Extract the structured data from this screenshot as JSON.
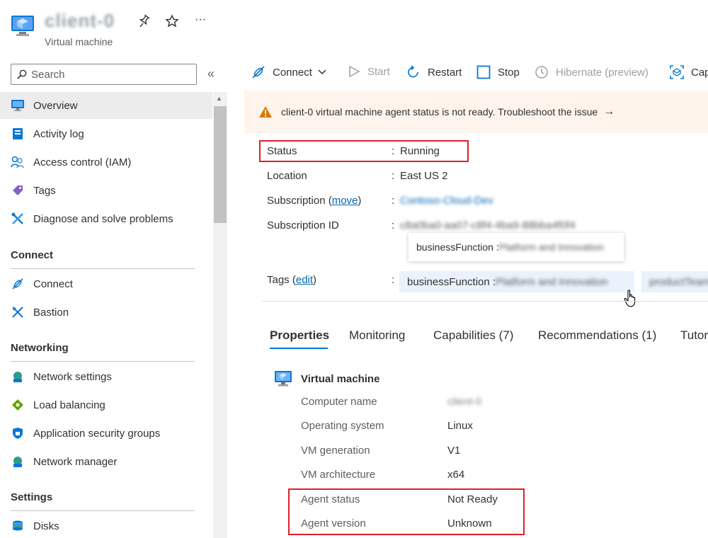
{
  "header": {
    "title": "client-0",
    "subtitle": "Virtual machine",
    "pin_icon": "pin-icon",
    "favorite_icon": "star-icon",
    "more_label": "···"
  },
  "sidebar": {
    "search_placeholder": "Search",
    "collapse_label": "«",
    "items": [
      {
        "label": "Overview",
        "icon": "overview-icon",
        "active": true
      },
      {
        "label": "Activity log",
        "icon": "activity-log-icon"
      },
      {
        "label": "Access control (IAM)",
        "icon": "people-icon"
      },
      {
        "label": "Tags",
        "icon": "tag-icon"
      },
      {
        "label": "Diagnose and solve problems",
        "icon": "wrench-icon"
      }
    ],
    "sections": [
      {
        "title": "Connect",
        "items": [
          {
            "label": "Connect",
            "icon": "connect-icon"
          },
          {
            "label": "Bastion",
            "icon": "bastion-icon"
          }
        ]
      },
      {
        "title": "Networking",
        "items": [
          {
            "label": "Network settings",
            "icon": "network-icon"
          },
          {
            "label": "Load balancing",
            "icon": "load-balancer-icon"
          },
          {
            "label": "Application security groups",
            "icon": "shield-icon"
          },
          {
            "label": "Network manager",
            "icon": "network-manager-icon"
          }
        ]
      },
      {
        "title": "Settings",
        "items": [
          {
            "label": "Disks",
            "icon": "disks-icon"
          }
        ]
      }
    ]
  },
  "toolbar": {
    "connect": "Connect",
    "start": "Start",
    "restart": "Restart",
    "stop": "Stop",
    "hibernate": "Hibernate (preview)",
    "capture": "Cap"
  },
  "banner": {
    "text": "client-0 virtual machine agent status is not ready. Troubleshoot the issue",
    "arrow": "→"
  },
  "essentials": {
    "status_label": "Status",
    "status_value": "Running",
    "location_label": "Location",
    "location_value": "East US 2",
    "subscription_label_prefix": "Subscription (",
    "subscription_move": "move",
    "subscription_label_suffix": ")",
    "subscription_value": "Contoso-Cloud-Dev",
    "subscription_id_label": "Subscription ID",
    "subscription_id_value": "c8a0ba0-aa07-c8f4-4ba9-88bba4f0f4",
    "tags_label_prefix": "Tags (",
    "tags_edit": "edit",
    "tags_label_suffix": ")",
    "colon": ":",
    "tooltip_key": "businessFunction : ",
    "tooltip_value": "Platform and Innovation",
    "tag1_key": "businessFunction : ",
    "tag1_value": "Platform and Innovation",
    "tag2_value": "productTeam"
  },
  "tabs": [
    {
      "label": "Properties",
      "active": true
    },
    {
      "label": "Monitoring"
    },
    {
      "label": "Capabilities (7)"
    },
    {
      "label": "Recommendations (1)"
    },
    {
      "label": "Tutor"
    }
  ],
  "properties": {
    "section_title": "Virtual machine",
    "rows": [
      {
        "label": "Computer name",
        "value": "client-0",
        "blurred": true
      },
      {
        "label": "Operating system",
        "value": "Linux"
      },
      {
        "label": "VM generation",
        "value": "V1"
      },
      {
        "label": "VM architecture",
        "value": "x64"
      },
      {
        "label": "Agent status",
        "value": "Not Ready"
      },
      {
        "label": "Agent version",
        "value": "Unknown"
      }
    ]
  },
  "colors": {
    "accent": "#0078d4",
    "highlight_box": "#e0202a",
    "warning": "#d97706",
    "banner_bg": "#fff4ec"
  }
}
